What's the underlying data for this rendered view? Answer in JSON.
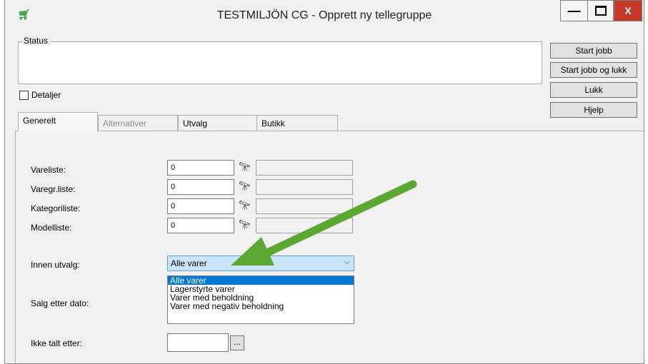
{
  "window": {
    "title": "TESTMILJÖN CG  -  Opprett ny tellegruppe",
    "app_icon": "cart-icon",
    "min_label": "—",
    "max_label": "",
    "close_label": "X"
  },
  "status": {
    "legend": "Status",
    "value": ""
  },
  "buttons": {
    "start": "Start jobb",
    "start_close": "Start jobb og lukk",
    "close": "Lukk",
    "help": "Hjelp"
  },
  "details": {
    "label": "Detaljer",
    "checked": false
  },
  "tabs": [
    {
      "label": "Generelt",
      "active": true
    },
    {
      "label": "Alternativer",
      "disabled": true
    },
    {
      "label": "Utvalg"
    },
    {
      "label": "Butikk"
    }
  ],
  "fields": [
    {
      "label": "Vareliste:",
      "value": "0"
    },
    {
      "label": "Varegr.liste:",
      "value": "0"
    },
    {
      "label": "Kategoriliste:",
      "value": "0"
    },
    {
      "label": "Modelliste:",
      "value": "0"
    }
  ],
  "innen_utvalg": {
    "label": "Innen utvalg:",
    "selected": "Alle varer",
    "options": [
      "Alle varer",
      "Lagerstyrte varer",
      "Varer med beholdning",
      "Varer med negativ beholdning"
    ]
  },
  "salg_etter_dato": {
    "label": "Salg etter dato:"
  },
  "ikke_talt_etter": {
    "label": "Ikke talt etter:",
    "value": "",
    "button": "..."
  },
  "colors": {
    "annotation_arrow": "#5aa832",
    "selection": "#0078d7",
    "close_button": "#c7372a"
  }
}
